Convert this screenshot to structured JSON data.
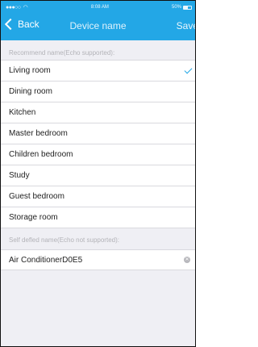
{
  "status_bar": {
    "signal_dots": "●●●○○",
    "wifi_icon": "wifi-icon",
    "time": "8:08 AM",
    "battery": "50%"
  },
  "nav": {
    "back_label": "Back",
    "title": "Device name",
    "save_label": "Save"
  },
  "recommend": {
    "header": "Recommend name(Echo supported):",
    "items": [
      {
        "label": "Living room",
        "selected": true
      },
      {
        "label": "Dining room",
        "selected": false
      },
      {
        "label": "Kitchen",
        "selected": false
      },
      {
        "label": "Master bedroom",
        "selected": false
      },
      {
        "label": "Children bedroom",
        "selected": false
      },
      {
        "label": "Study",
        "selected": false
      },
      {
        "label": "Guest bedroom",
        "selected": false
      },
      {
        "label": "Storage room",
        "selected": false
      }
    ]
  },
  "custom": {
    "header": "Self defled name(Echo not supported):",
    "value": "Air ConditionerD0E5"
  },
  "colors": {
    "accent": "#23a7e6",
    "background": "#efeff4"
  }
}
